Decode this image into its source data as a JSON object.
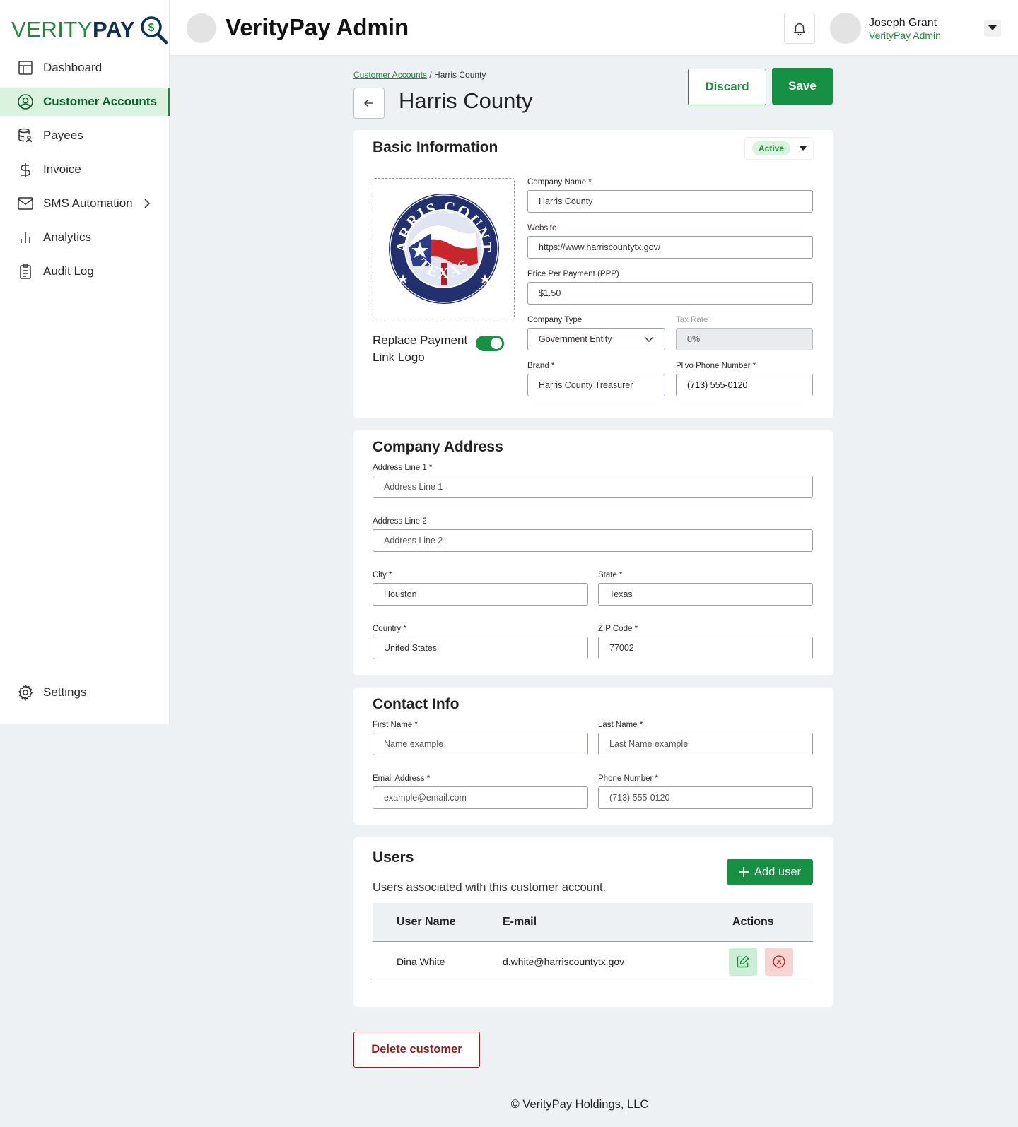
{
  "brand": {
    "logo_part1": "VERITY",
    "logo_part2": "PAY"
  },
  "header": {
    "title": "VerityPay Admin",
    "user_name": "Joseph Grant",
    "user_role": "VerityPay Admin"
  },
  "sidebar": {
    "items": [
      {
        "label": "Dashboard",
        "icon": "dashboard-icon"
      },
      {
        "label": "Customer Accounts",
        "icon": "user-circle-icon",
        "active": true
      },
      {
        "label": "Payees",
        "icon": "database-user-icon"
      },
      {
        "label": "Invoice",
        "icon": "dollar-icon"
      },
      {
        "label": "SMS Automation",
        "icon": "mail-icon"
      },
      {
        "label": "Analytics",
        "icon": "bar-chart-icon"
      },
      {
        "label": "Audit Log",
        "icon": "clipboard-icon"
      }
    ],
    "settings_label": "Settings"
  },
  "breadcrumb": {
    "parent": "Customer Accounts",
    "current": "/ Harris County"
  },
  "page": {
    "title": "Harris County",
    "discard_label": "Discard",
    "save_label": "Save"
  },
  "basic": {
    "title": "Basic Information",
    "status": "Active",
    "logo_text_top": "HARRIS COUNTY",
    "logo_text_bottom": "TEXAS",
    "replace_logo_label": "Replace Payment Link Logo",
    "replace_logo_on": true,
    "company_name_label": "Company Name  *",
    "company_name_value": "Harris County",
    "website_label": "Website",
    "website_value": "https://www.harriscountytx.gov/",
    "ppp_label": "Price Per Payment (PPP)",
    "ppp_value": "$1.50",
    "company_type_label": "Company Type",
    "company_type_value": "Government Entity",
    "tax_rate_label": "Tax Rate",
    "tax_rate_placeholder": "0%",
    "brand_label": "Brand  *",
    "brand_value": "Harris County Treasurer",
    "plivo_label": "Plivo Phone Number  *",
    "plivo_value": "(713) 555-0120"
  },
  "address": {
    "title": "Company Address",
    "line1_label": "Address Line 1  *",
    "line1_placeholder": "Address Line 1",
    "line2_label": "Address Line 2",
    "line2_placeholder": "Address Line 2",
    "city_label": "City  *",
    "city_value": "Houston",
    "state_label": "State  *",
    "state_value": "Texas",
    "country_label": "Country  *",
    "country_value": "United States",
    "zip_label": "ZIP Code  *",
    "zip_value": "77002"
  },
  "contact": {
    "title": "Contact Info",
    "first_label": "First Name  *",
    "first_placeholder": "Name example",
    "last_label": "Last Name  *",
    "last_placeholder": "Last Name example",
    "email_label": "Email Address  *",
    "email_placeholder": "example@email.com",
    "phone_label": "Phone Number  *",
    "phone_placeholder": "(713) 555-0120"
  },
  "users": {
    "title": "Users",
    "subtitle": "Users associated with this customer account.",
    "add_label": "Add user",
    "columns": [
      "User Name",
      "E-mail",
      "Actions"
    ],
    "rows": [
      {
        "name": "Dina White",
        "email": "d.white@harriscountytx.gov"
      }
    ]
  },
  "delete_label": "Delete customer",
  "footer": "© VerityPay Holdings, LLC",
  "colors": {
    "accent": "#169143",
    "danger": "#8b1d1d",
    "active_bg": "#d9f3df"
  }
}
